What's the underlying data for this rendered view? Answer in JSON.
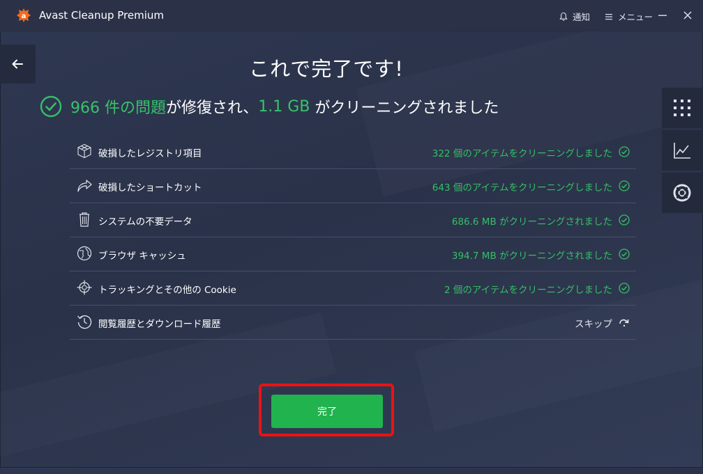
{
  "titlebar": {
    "app_title": "Avast Cleanup Premium",
    "notifications_label": "通知",
    "menu_label": "メニュー",
    "icons": [
      "bell-icon",
      "hamburger-icon",
      "minimize-icon",
      "close-icon"
    ]
  },
  "main": {
    "title": "これで完了です!",
    "summary": {
      "count": "966 件の問題",
      "text_fixed": "が修復され、",
      "size": "1.1 GB",
      "text_cleaned": " がクリーニングされました"
    },
    "items": [
      {
        "label": "破損したレジストリ項目",
        "result": "322 個のアイテムをクリーニングしました",
        "icon": "registry-cube-icon",
        "status": "done"
      },
      {
        "label": "破損したショートカット",
        "result": "643 個のアイテムをクリーニングしました",
        "icon": "shortcut-arrow-icon",
        "status": "done"
      },
      {
        "label": "システムの不要データ",
        "result": "686.6 MB がクリーニングされました",
        "icon": "trash-icon",
        "status": "done"
      },
      {
        "label": "ブラウザ キャッシュ",
        "result": "394.7 MB がクリーニングされました",
        "icon": "globe-icon",
        "status": "done"
      },
      {
        "label": "トラッキングとその他の Cookie",
        "result": "2 個のアイテムをクリーニングしました",
        "icon": "crosshair-icon",
        "status": "done"
      },
      {
        "label": "閲覧履歴とダウンロード履歴",
        "result": "スキップ",
        "icon": "history-icon",
        "status": "skipped"
      }
    ],
    "done_button": "完了"
  },
  "colors": {
    "accent_green": "#35bf66",
    "button_green": "#20b34e",
    "highlight_red": "#ee1111",
    "background": "#2f3852"
  }
}
